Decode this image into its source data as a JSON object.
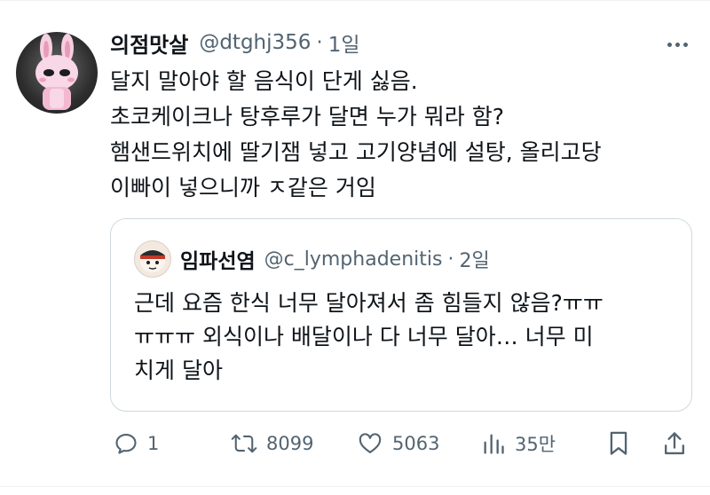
{
  "tweet": {
    "display_name": "의점맛살",
    "handle": "@dtghj356",
    "separator": "·",
    "time": "1일",
    "lines": [
      "달지 말아야 할 음식이 단게 싫음.",
      "초코케이크나 탕후루가 달면 누가 뭐라 함?",
      "햄샌드위치에 딸기잼 넣고 고기양념에 설탕, 올리고당",
      "이빠이 넣으니까 ㅈ같은 거임"
    ]
  },
  "quote": {
    "display_name": "임파선염",
    "handle": "@c_lymphadenitis",
    "separator": "·",
    "time": "2일",
    "lines": [
      "근데 요즘 한식 너무 달아져서 좀 힘들지 않음?ㅠㅠ",
      "ㅠㅠㅠ 외식이나 배달이나 다 너무 달아… 너무 미",
      "치게 달아"
    ]
  },
  "actions": {
    "reply_count": "1",
    "retweet_count": "8099",
    "like_count": "5063",
    "views_count": "35만"
  },
  "icons": {
    "reply": "reply-icon",
    "retweet": "retweet-icon",
    "like": "heart-icon",
    "views": "views-icon",
    "bookmark": "bookmark-icon",
    "share": "share-icon",
    "more": "more-icon"
  },
  "colors": {
    "text": "#0f1419",
    "secondary": "#536471",
    "border": "#cfd9de"
  }
}
